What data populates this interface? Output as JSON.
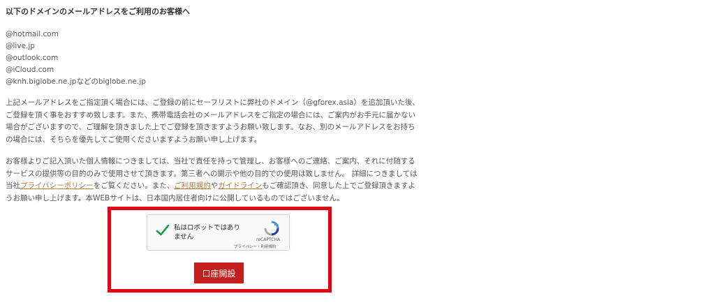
{
  "heading": "以下のドメインのメールアドレスをご利用のお客様へ",
  "domains": [
    "@hotmail.com",
    "@live.jp",
    "@outlook.com",
    "@iCloud.com",
    "@knh.biglobe.ne.jpなどのbiglobe.ne.jp"
  ],
  "paragraph1": [
    "上記メールアドレスをご指定頂く場合には、ご登録の前にセーフリストに弊社のドメイン（@gforex.asia）を追加頂いた後、",
    "ご登録を頂く事をおすすめ致します。また、携帯電話会社のメールアドレスをご指定の場合には、ご案内がお手元に届かない",
    "場合がございますので、ご理解を頂きました上でご登録を頂きますようお願い致します。なお、別のメールアドレスをお持ち",
    "の場合には、そちらを優先してご使用くださいますようお願い申し上げます。"
  ],
  "paragraph2": {
    "line1": "お客様よりご記入頂いた個人情報につきましては、当社で責任を持って管理し、お客様へのご連絡、ご案内、それに付随する",
    "line2": "サービスの提供等の目的のみで使用させて頂きます。第三者への開示や他の目的での使用は致しません。 詳細につきましては",
    "line3_prefix": "当社",
    "privacy_link": "プライバシーポリシー",
    "line3_mid1": "をご覧ください。また、",
    "terms_link": "ご利用規約",
    "line3_mid2": "や",
    "guideline_link": "ガイドライン",
    "line3_suffix": "もご確認頂き、同意した上でご登録頂きますよ",
    "line4": "うお願い申し上げます。本WEBサイトは、日本国内居住者向けに公開しているものではございません。"
  },
  "captcha": {
    "label_line1": "私はロボットではあり",
    "label_line2": "ません",
    "brand": "reCAPTCHA",
    "links": "プライバシー・利用規約"
  },
  "open_account_button": "口座開設",
  "colors": {
    "highlight": "#e50012",
    "button": "#c41f1f",
    "link": "#b07a3a",
    "check": "#1a9e4b"
  }
}
